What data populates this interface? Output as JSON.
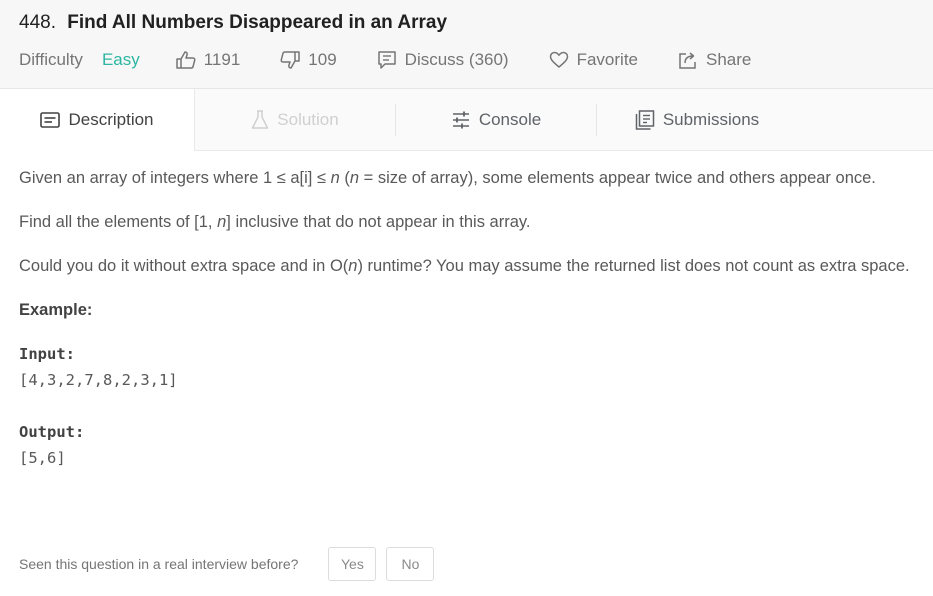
{
  "problem": {
    "number": "448.",
    "title": "Find All Numbers Disappeared in an Array"
  },
  "meta": {
    "difficulty_label": "Difficulty",
    "difficulty_value": "Easy",
    "likes": "1191",
    "dislikes": "109",
    "discuss": "Discuss (360)",
    "favorite": "Favorite",
    "share": "Share"
  },
  "tabs": [
    {
      "label": "Description",
      "icon": "description-icon",
      "state": "active"
    },
    {
      "label": "Solution",
      "icon": "flask-icon",
      "state": "disabled"
    },
    {
      "label": "Console",
      "icon": "sliders-icon",
      "state": "normal"
    },
    {
      "label": "Submissions",
      "icon": "submissions-icon",
      "state": "normal"
    }
  ],
  "description": {
    "p1_a": "Given an array of integers where 1 ≤ a[i] ≤ ",
    "p1_n1": "n",
    "p1_b": " (",
    "p1_n2": "n",
    "p1_c": " = size of array), some elements appear twice and others appear once.",
    "p2_a": "Find all the elements of [1, ",
    "p2_n": "n",
    "p2_b": "] inclusive that do not appear in this array.",
    "p3_a": "Could you do it without extra space and in O(",
    "p3_n": "n",
    "p3_b": ") runtime? You may assume the returned list does not count as extra space.",
    "example_label": "Example:",
    "input_label": "Input:",
    "input_value": "[4,3,2,7,8,2,3,1]",
    "output_label": "Output:",
    "output_value": "[5,6]"
  },
  "interview": {
    "question": "Seen this question in a real interview before?",
    "yes": "Yes",
    "no": "No"
  },
  "colors": {
    "easy": "#2db7a2",
    "header_bg": "#f7f7f7"
  }
}
